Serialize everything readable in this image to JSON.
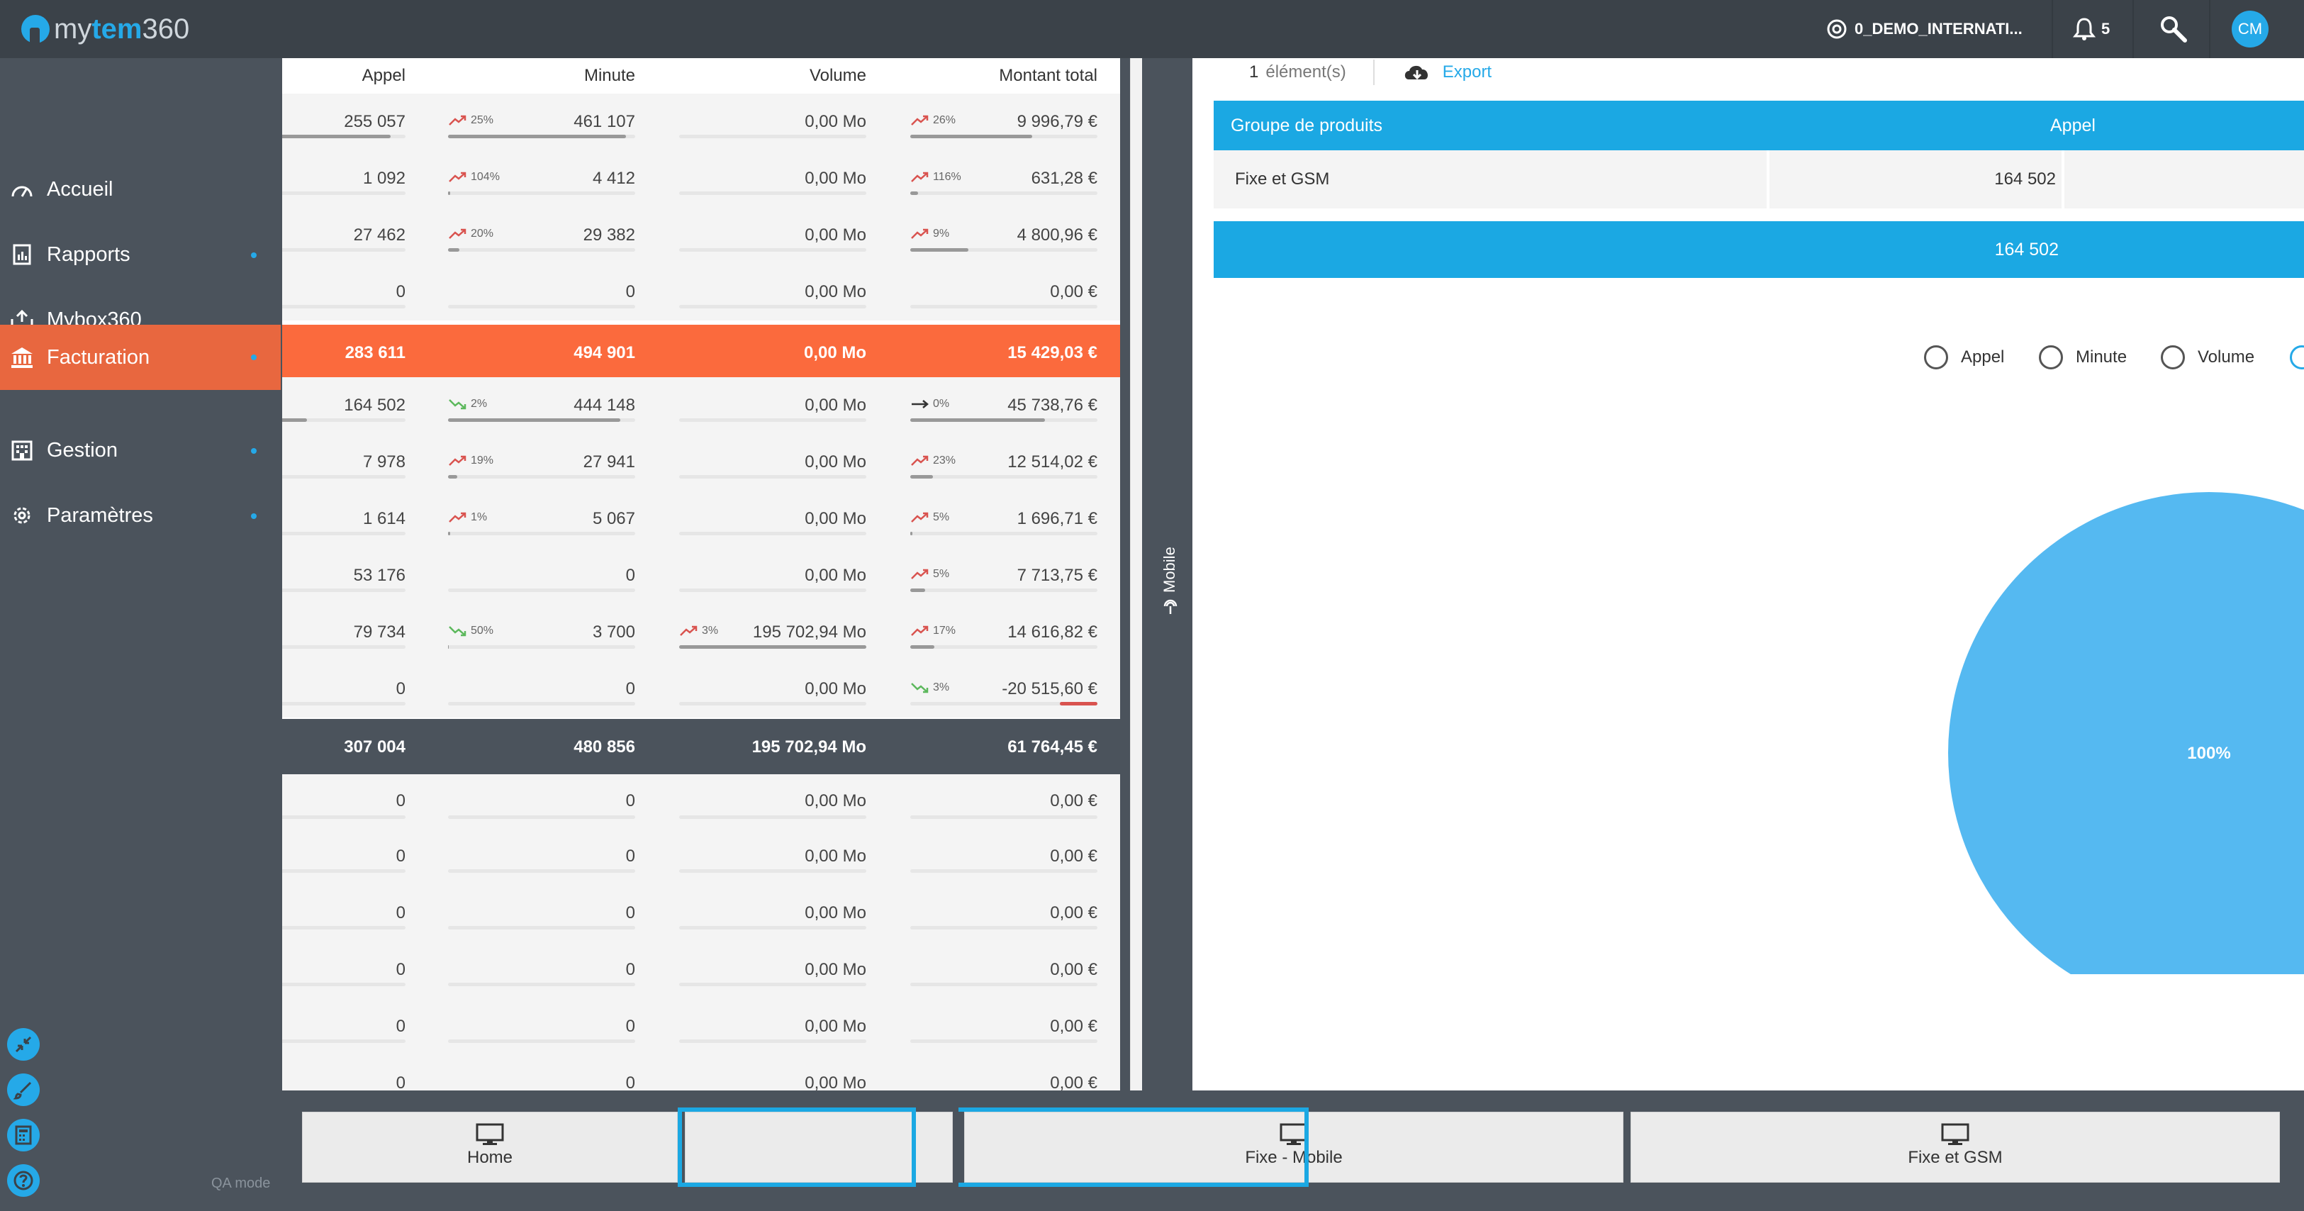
{
  "app": {
    "logo_prefix": "my",
    "logo_brand": "tem",
    "logo_suffix": "360",
    "account": "0_DEMO_INTERNATI...",
    "notifications": "5",
    "user_initials": "CM",
    "qa_mode": "QA mode"
  },
  "sidebar": {
    "items": [
      {
        "label": "Accueil",
        "icon": "dashboard-icon",
        "dot": false
      },
      {
        "label": "Rapports",
        "icon": "report-icon",
        "dot": true
      },
      {
        "label": "Mybox360",
        "icon": "box-icon",
        "dot": false
      },
      {
        "label": "Facturation",
        "icon": "bank-icon",
        "dot": true,
        "active": true
      },
      {
        "label": "Gestion",
        "icon": "building-icon",
        "dot": true
      },
      {
        "label": "Paramètres",
        "icon": "gear-icon",
        "dot": true
      }
    ]
  },
  "table": {
    "headers": {
      "appel": "Appel",
      "minute": "Minute",
      "volume": "Volume",
      "montant": "Montant total"
    },
    "rows": [
      {
        "type": "normal",
        "appel": "255 057",
        "appel_fill": 0.9,
        "minute": "461 107",
        "minute_pct": "25%",
        "minute_dir": "up",
        "minute_fill": 0.95,
        "volume": "0,00 Mo",
        "montant": "9 996,79 €",
        "montant_pct": "26%",
        "montant_dir": "up",
        "montant_fill": 0.65
      },
      {
        "type": "normal",
        "appel": "1 092",
        "minute": "4 412",
        "minute_pct": "104%",
        "minute_dir": "up",
        "minute_fill": 0.01,
        "volume": "0,00 Mo",
        "montant": "631,28 €",
        "montant_pct": "116%",
        "montant_dir": "up",
        "montant_fill": 0.04
      },
      {
        "type": "normal",
        "appel": "27 462",
        "minute": "29 382",
        "minute_pct": "20%",
        "minute_dir": "up",
        "minute_fill": 0.06,
        "volume": "0,00 Mo",
        "montant": "4 800,96 €",
        "montant_pct": "9%",
        "montant_dir": "up",
        "montant_fill": 0.31
      },
      {
        "type": "normal",
        "appel": "0",
        "minute": "0",
        "volume": "0,00 Mo",
        "montant": "0,00 €"
      },
      {
        "type": "orange",
        "appel": "283 611",
        "minute": "494 901",
        "volume": "0,00 Mo",
        "montant": "15 429,03 €"
      },
      {
        "type": "normal",
        "appel": "164 502",
        "appel_fill": 0.35,
        "minute": "444 148",
        "minute_pct": "2%",
        "minute_dir": "down",
        "minute_fill": 0.92,
        "volume": "0,00 Mo",
        "montant": "45 738,76 €",
        "montant_pct": "0%",
        "montant_dir": "flat",
        "montant_fill": 0.72
      },
      {
        "type": "normal",
        "appel": "7 978",
        "minute": "27 941",
        "minute_pct": "19%",
        "minute_dir": "up",
        "minute_fill": 0.05,
        "volume": "0,00 Mo",
        "montant": "12 514,02 €",
        "montant_pct": "23%",
        "montant_dir": "up",
        "montant_fill": 0.12
      },
      {
        "type": "normal",
        "appel": "1 614",
        "minute": "5 067",
        "minute_pct": "1%",
        "minute_dir": "up",
        "minute_fill": 0.01,
        "volume": "0,00 Mo",
        "montant": "1 696,71 €",
        "montant_pct": "5%",
        "montant_dir": "up",
        "montant_fill": 0.01
      },
      {
        "type": "normal",
        "appel": "53 176",
        "minute": "0",
        "volume": "0,00 Mo",
        "montant": "7 713,75 €",
        "montant_pct": "5%",
        "montant_dir": "up",
        "montant_fill": 0.08
      },
      {
        "type": "normal",
        "appel": "79 734",
        "minute": "3 700",
        "minute_pct": "50%",
        "minute_dir": "down",
        "minute_fill": 0.005,
        "volume": "195 702,94 Mo",
        "volume_pct": "3%",
        "volume_dir": "up",
        "volume_fill": 1.0,
        "montant": "14 616,82 €",
        "montant_pct": "17%",
        "montant_dir": "up",
        "montant_fill": 0.13
      },
      {
        "type": "normal",
        "appel": "0",
        "minute": "0",
        "volume": "0,00 Mo",
        "montant": "-20 515,60 €",
        "montant_pct": "3%",
        "montant_dir": "down",
        "montant_neg": 0.2
      },
      {
        "type": "dark",
        "appel": "307 004",
        "minute": "480 856",
        "volume": "195 702,94 Mo",
        "montant": "61 764,45 €"
      },
      {
        "type": "normal",
        "appel": "0",
        "minute": "0",
        "volume": "0,00 Mo",
        "montant": "0,00 €"
      },
      {
        "type": "normal",
        "appel": "0",
        "minute": "0",
        "volume": "0,00 Mo",
        "montant": "0,00 €"
      },
      {
        "type": "normal",
        "appel": "0",
        "minute": "0",
        "volume": "0,00 Mo",
        "montant": "0,00 €"
      },
      {
        "type": "normal",
        "appel": "0",
        "minute": "0",
        "volume": "0,00 Mo",
        "montant": "0,00 €"
      },
      {
        "type": "normal",
        "appel": "0",
        "minute": "0",
        "volume": "0,00 Mo",
        "montant": "0,00 €"
      },
      {
        "type": "normal",
        "appel": "0",
        "minute": "0",
        "volume": "0,00 Mo",
        "montant": "0,00 €"
      }
    ]
  },
  "splitter": {
    "label": "Mobile"
  },
  "right": {
    "count": "1",
    "count_label": "élément(s)",
    "export_label": "Export",
    "head": {
      "group": "Groupe de produits",
      "appel": "Appel"
    },
    "row": {
      "group": "Fixe et GSM",
      "appel": "164 502"
    },
    "total": "164 502",
    "legend": [
      "Appel",
      "Minute",
      "Volume"
    ],
    "pie_label": "100%",
    "pie_color": "#55b9f1"
  },
  "bottom_tabs": [
    {
      "label": "Home",
      "icon": "monitor-icon"
    },
    {
      "label": "",
      "icon": ""
    },
    {
      "label": "Fixe - Mobile",
      "icon": "monitor-icon"
    },
    {
      "label": "Fixe et GSM",
      "icon": "monitor-icon"
    }
  ],
  "colors": {
    "accent": "#1ba8e3",
    "active": "#e8673f",
    "total_orange": "#fb6a3d",
    "dark": "#4b535c",
    "trend_up": "#d9534f",
    "trend_down": "#5cb85c"
  }
}
